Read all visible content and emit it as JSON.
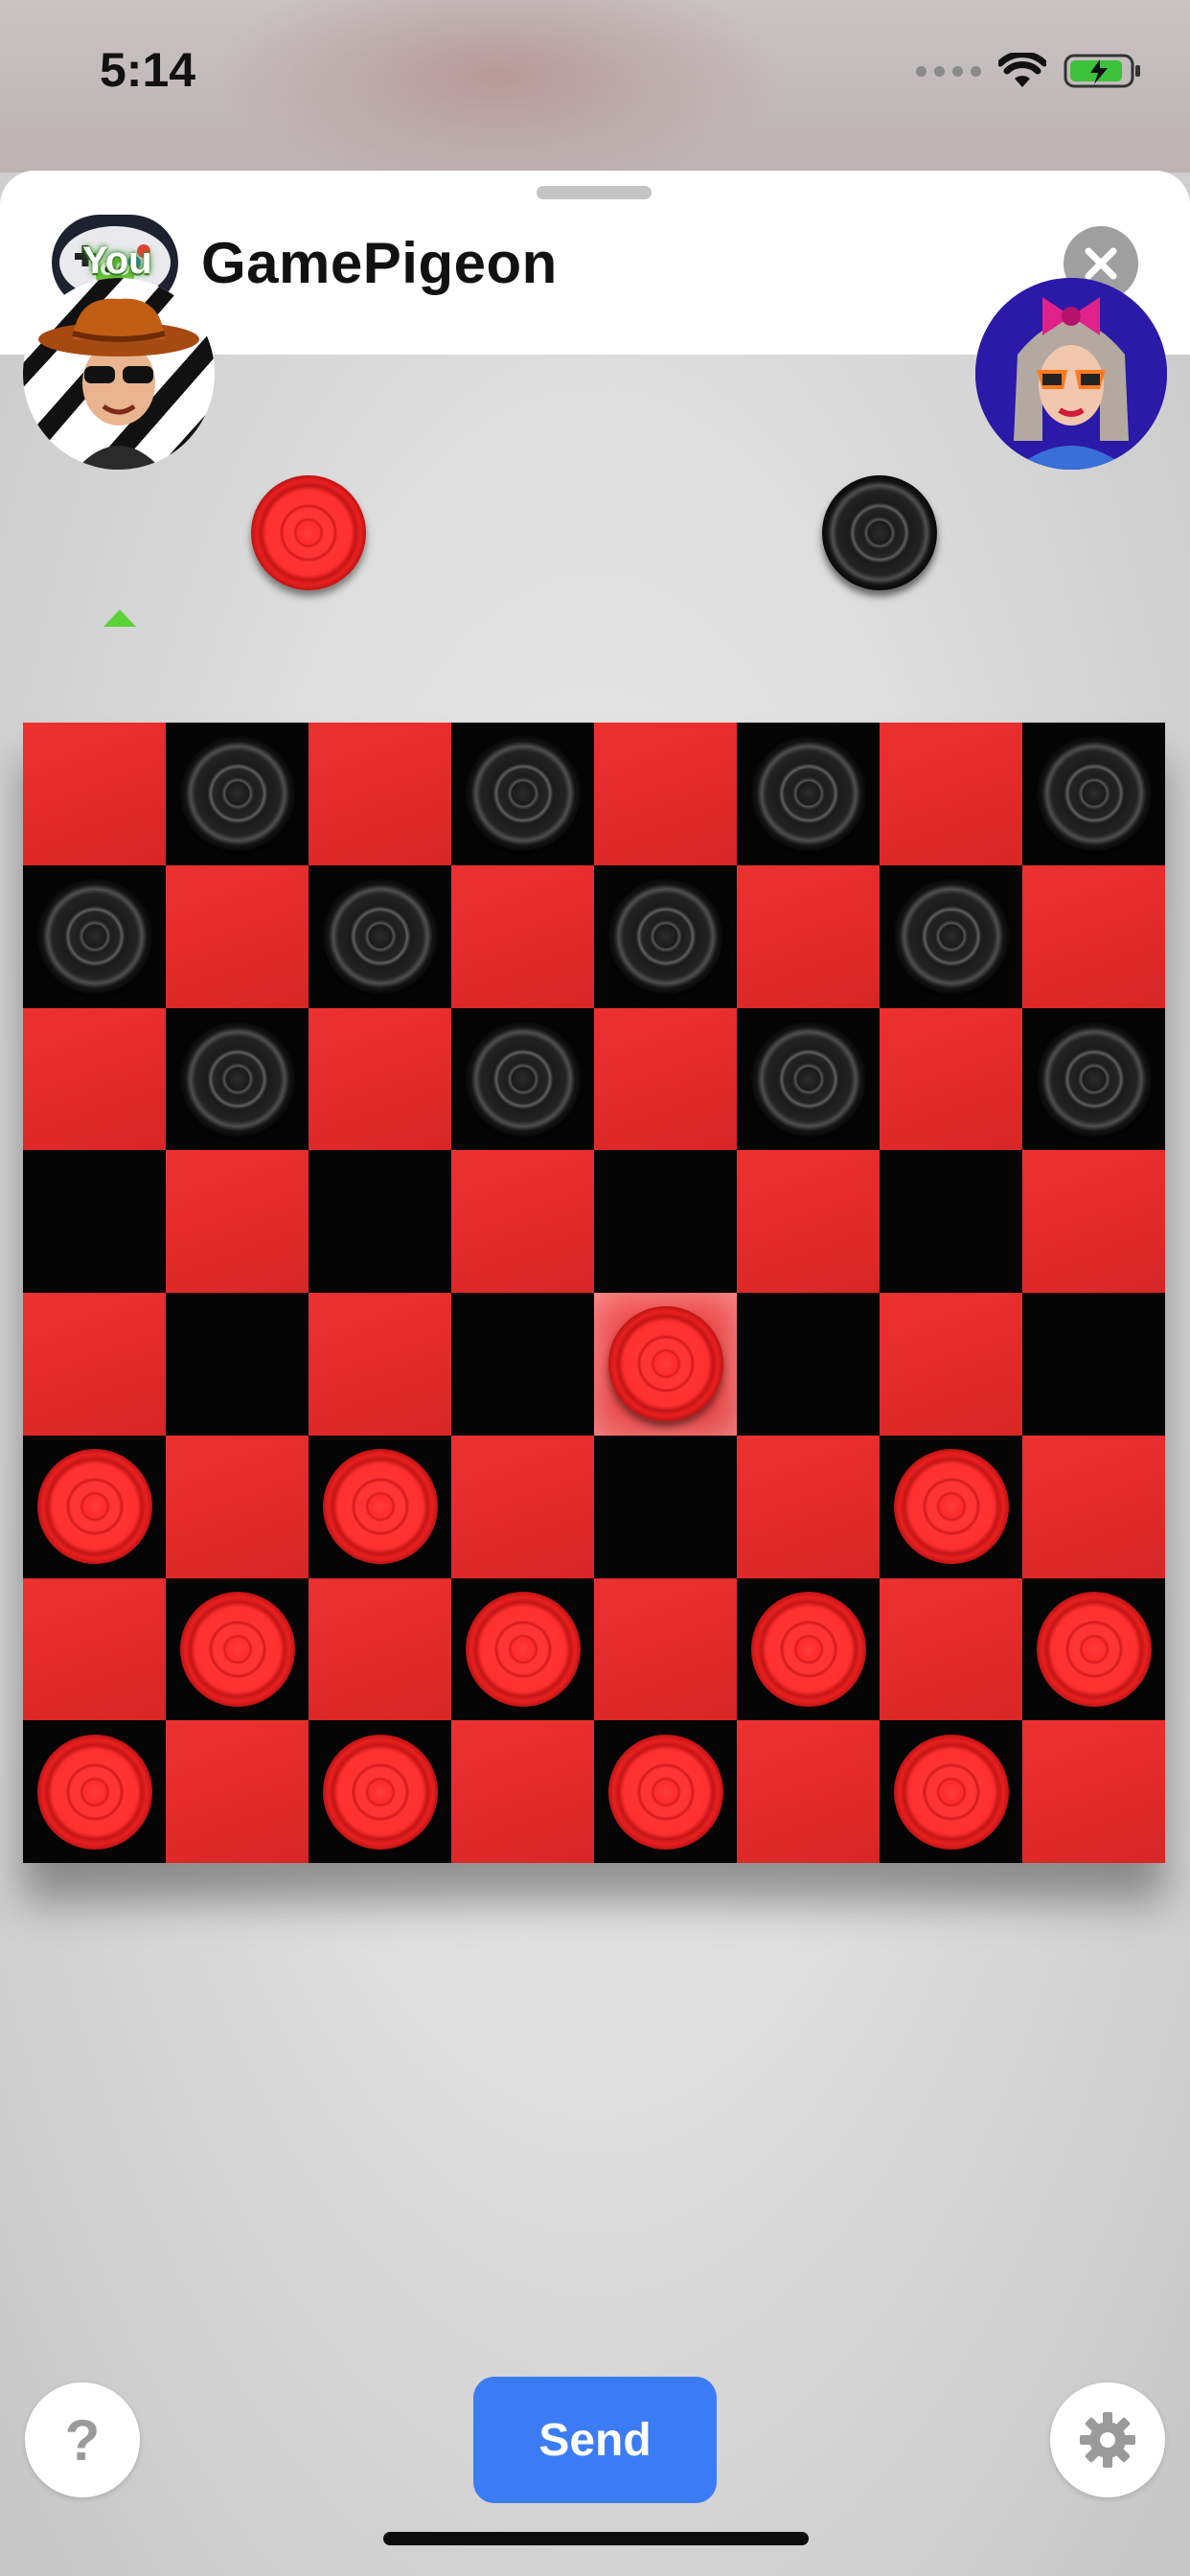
{
  "status_bar": {
    "time": "5:14"
  },
  "header": {
    "title": "GamePigeon"
  },
  "players": {
    "me_label": "You"
  },
  "board": {
    "rows": [
      [
        "",
        "b",
        "",
        "b",
        "",
        "b",
        "",
        "b"
      ],
      [
        "b",
        "",
        "b",
        "",
        "b",
        "",
        "b",
        ""
      ],
      [
        "",
        "b",
        "",
        "b",
        "",
        "b",
        "",
        "b"
      ],
      [
        "",
        "",
        "",
        "",
        "",
        "",
        "",
        ""
      ],
      [
        "",
        "",
        "",
        "",
        "r*",
        "",
        "",
        ""
      ],
      [
        "r",
        "",
        "r",
        "",
        "",
        "",
        "r",
        ""
      ],
      [
        "",
        "r",
        "",
        "r",
        "",
        "r",
        "",
        "r"
      ],
      [
        "r",
        "",
        "r",
        "",
        "r",
        "",
        "r",
        ""
      ]
    ],
    "colors": {
      "light": "#e12a2a",
      "dark": "#050505",
      "red_piece": "#ff3030",
      "black_piece": "#1d1d1d"
    }
  },
  "controls": {
    "help_label": "?",
    "send_label": "Send"
  }
}
